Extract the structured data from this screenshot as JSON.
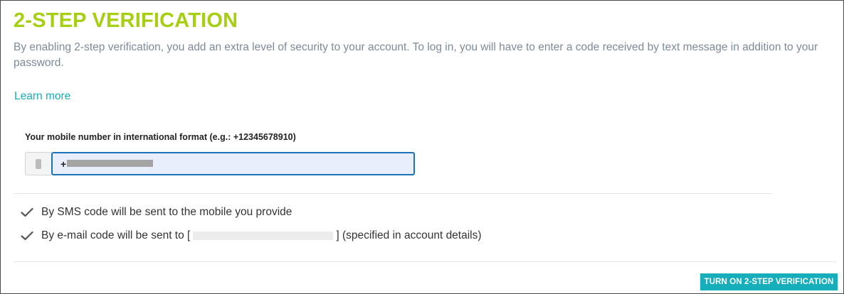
{
  "header": {
    "title": "2-STEP VERIFICATION",
    "description": "By enabling 2-step verification, you add an extra level of security to your account. To log in, you will have to enter a code received by text message in addition to your password.",
    "learn_more": "Learn more"
  },
  "phone": {
    "label": "Your mobile number in international format (e.g.: +12345678910)",
    "prefix": "+",
    "icon": "mobile-phone-icon",
    "value_redacted": true
  },
  "checks": [
    {
      "icon": "checkmark-icon",
      "text": "By SMS code will be sent to the mobile you provide"
    },
    {
      "icon": "checkmark-icon",
      "text_before": "By e-mail code will be sent to [",
      "text_after": "] (specified in account details)"
    }
  ],
  "actions": {
    "turn_on_label": "TURN ON 2-STEP VERIFICATION"
  },
  "colors": {
    "title": "#a6cf12",
    "accent": "#16aebb",
    "description": "#7d8a99",
    "input_focus_border": "#1d72b8",
    "input_bg": "#e8eefc"
  }
}
